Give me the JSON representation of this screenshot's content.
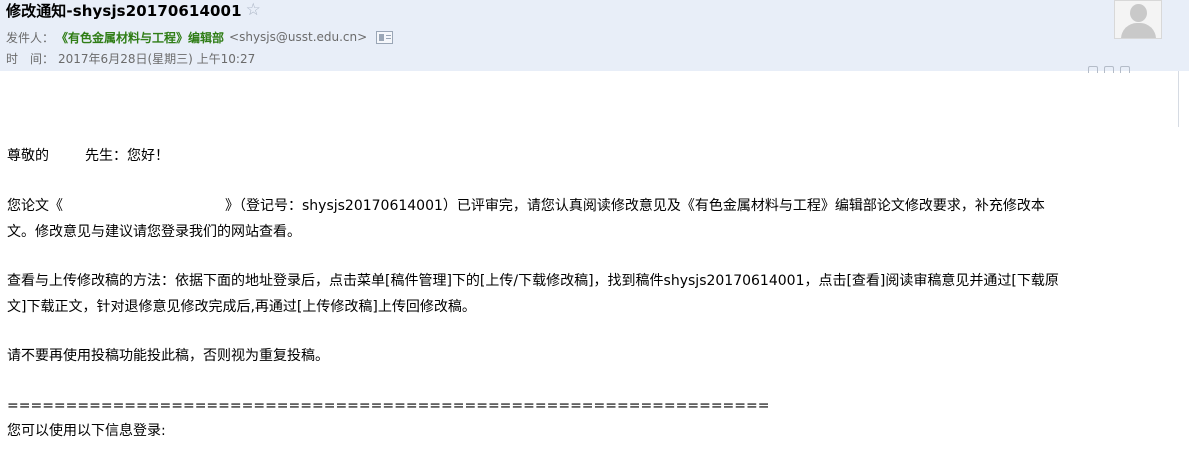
{
  "email": {
    "subject": "修改通知-shysjs20170614001",
    "sender_label": "发件人：",
    "sender_name": "《有色金属材料与工程》编辑部",
    "sender_email": "<shysjs@usst.edu.cn>",
    "time_label": "时　间：",
    "time_value": "2017年6月28日(星期三) 上午10:27"
  },
  "body": {
    "greeting_start": "尊敬的",
    "greeting_end": "先生：您好！",
    "p1_line1_start": "您论文《",
    "p1_line1_rest": "》（登记号：shysjs20170614001）已评审完，请您认真阅读修改意见及《有色金属材料与工程》编辑部论文修改要求，补充修改本",
    "p1_line2": "文。修改意见与建议请您登录我们的网站查看。",
    "p2_line1": "查看与上传修改稿的方法：依据下面的地址登录后，点击菜单[稿件管理]下的[上传/下载修改稿]，找到稿件shysjs20170614001，点击[查看]阅读审稿意见并通过[下载原",
    "p2_line2": "文]下载正文，针对退修意见修改完成后,再通过[上传修改稿]上传回修改稿。",
    "p3": "请不要再使用投稿功能投此稿，否则视为重复投稿。",
    "separator": "=================================================================",
    "p4": "您可以使用以下信息登录:"
  }
}
